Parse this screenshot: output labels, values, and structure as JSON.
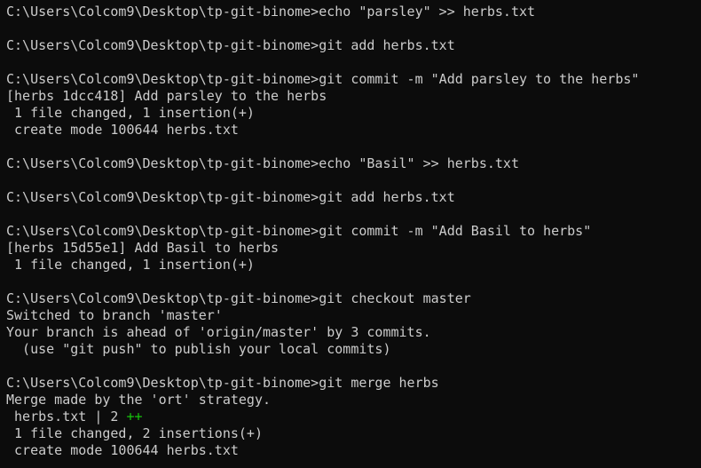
{
  "terminal": {
    "colors": {
      "background": "#0c0c0c",
      "foreground": "#cccccc",
      "diff_plus": "#16c60c"
    },
    "lines": [
      "C:\\Users\\Colcom9\\Desktop\\tp-git-binome>echo \"parsley\" >> herbs.txt",
      "",
      "C:\\Users\\Colcom9\\Desktop\\tp-git-binome>git add herbs.txt",
      "",
      "C:\\Users\\Colcom9\\Desktop\\tp-git-binome>git commit -m \"Add parsley to the herbs\"",
      "[herbs 1dcc418] Add parsley to the herbs",
      " 1 file changed, 1 insertion(+)",
      " create mode 100644 herbs.txt",
      "",
      "C:\\Users\\Colcom9\\Desktop\\tp-git-binome>echo \"Basil\" >> herbs.txt",
      "",
      "C:\\Users\\Colcom9\\Desktop\\tp-git-binome>git add herbs.txt",
      "",
      "C:\\Users\\Colcom9\\Desktop\\tp-git-binome>git commit -m \"Add Basil to herbs\"",
      "[herbs 15d55e1] Add Basil to herbs",
      " 1 file changed, 1 insertion(+)",
      "",
      "C:\\Users\\Colcom9\\Desktop\\tp-git-binome>git checkout master",
      "Switched to branch 'master'",
      "Your branch is ahead of 'origin/master' by 3 commits.",
      "  (use \"git push\" to publish your local commits)",
      "",
      "C:\\Users\\Colcom9\\Desktop\\tp-git-binome>git merge herbs",
      "Merge made by the 'ort' strategy.",
      {
        "prefix": " herbs.txt | 2 ",
        "highlight": "++"
      },
      " 1 file changed, 2 insertions(+)",
      " create mode 100644 herbs.txt"
    ]
  }
}
